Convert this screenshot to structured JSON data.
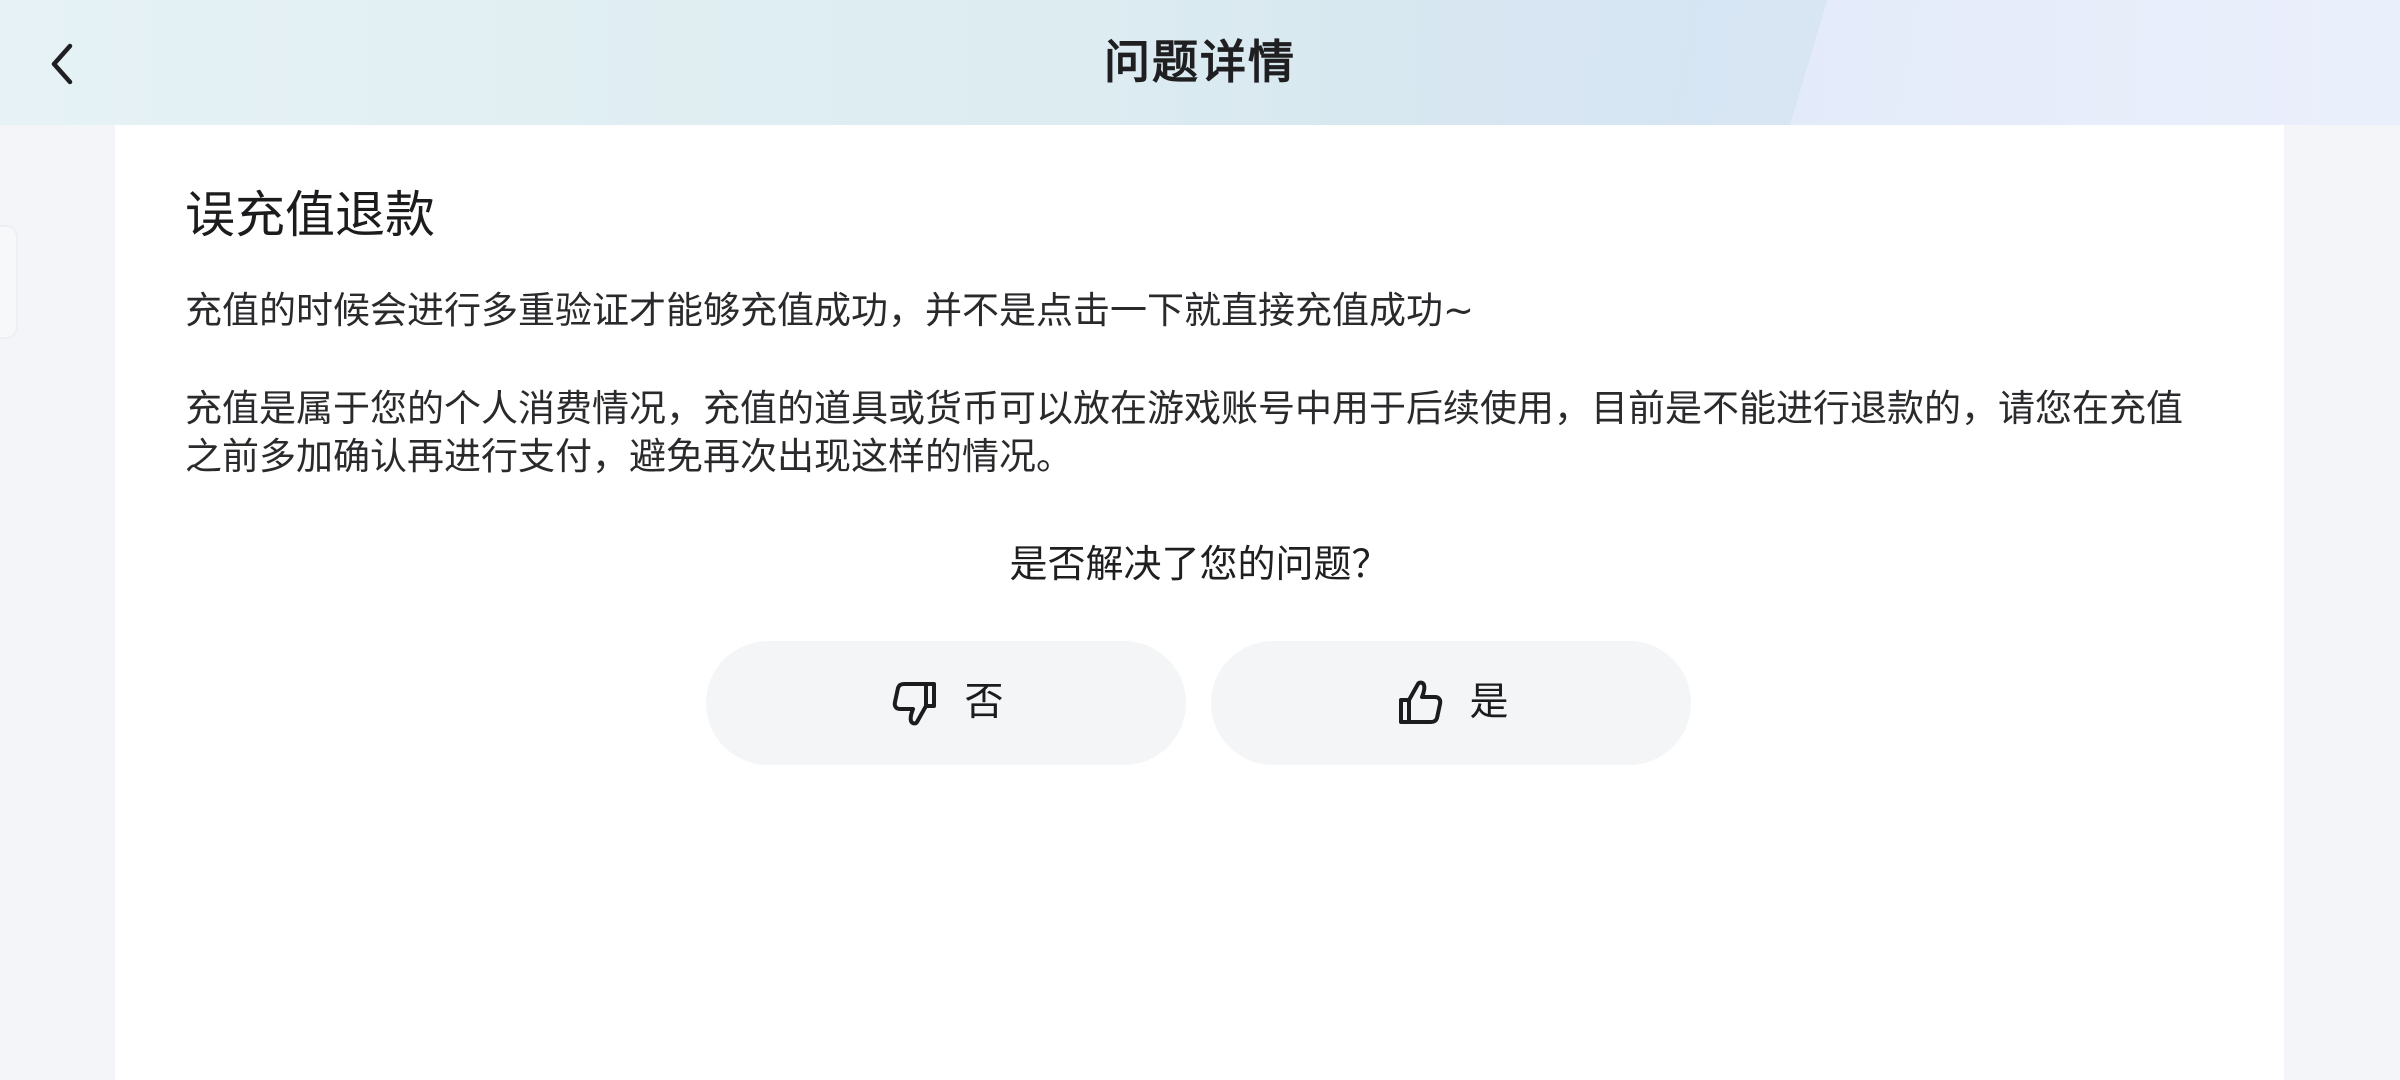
{
  "header": {
    "title": "问题详情",
    "back_icon": "chevron-left-icon"
  },
  "article": {
    "title": "误充值退款",
    "paragraphs": [
      "充值的时候会进行多重验证才能够充值成功，并不是点击一下就直接充值成功~",
      "充值是属于您的个人消费情况，充值的道具或货币可以放在游戏账号中用于后续使用，目前是不能进行退款的，请您在充值之前多加确认再进行支付，避免再次出现这样的情况。"
    ]
  },
  "feedback": {
    "question": "是否解决了您的问题？",
    "no": {
      "label": "否",
      "icon": "thumbs-down-icon"
    },
    "yes": {
      "label": "是",
      "icon": "thumbs-up-icon"
    }
  },
  "colors": {
    "header_bg": "#dcecf1",
    "card_bg": "#ffffff",
    "page_bg": "#f3f5f8",
    "button_bg": "#f3f5f7",
    "text": "#1c1c1e"
  }
}
